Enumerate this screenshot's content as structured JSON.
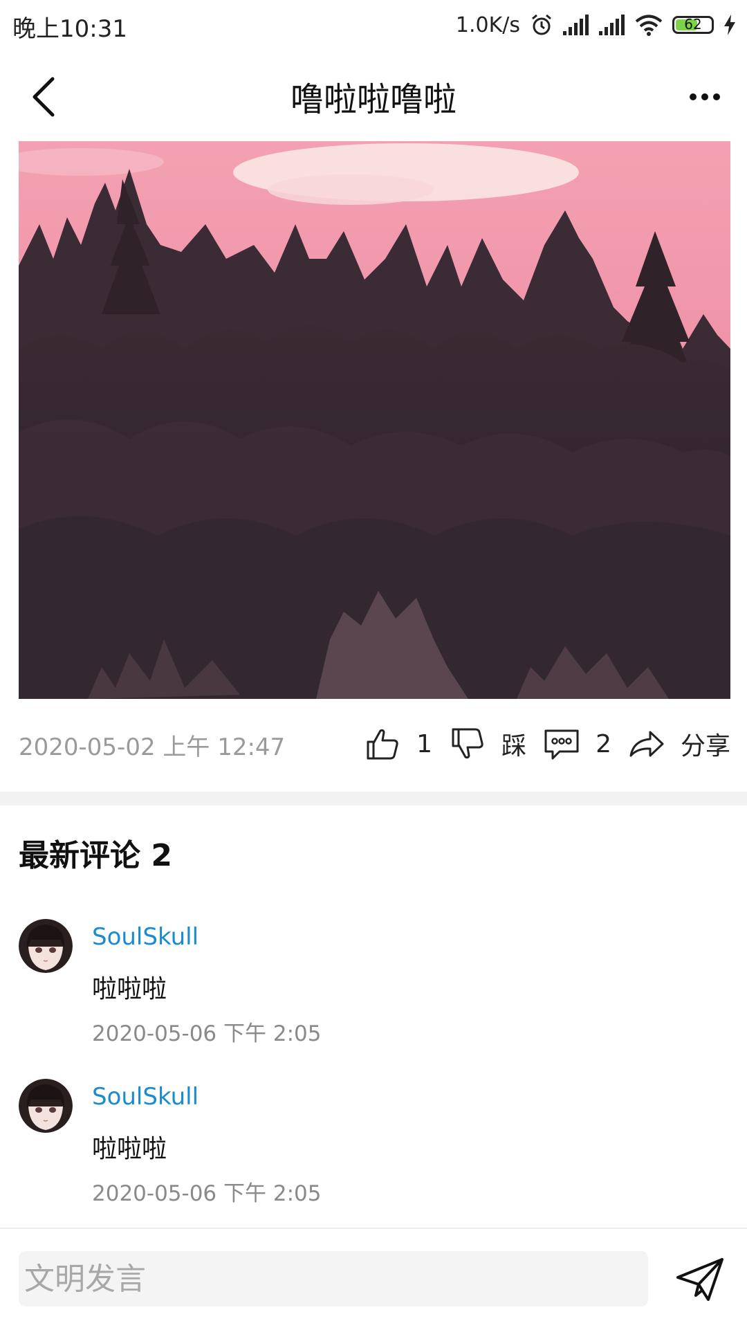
{
  "status_bar": {
    "time": "晚上10:31",
    "net_speed": "1.0K/s",
    "battery": "62",
    "battery_level": 0.62
  },
  "header": {
    "title": "噜啦啦噜啦",
    "icons": [
      "back-arrow-icon",
      "more-dots-icon"
    ]
  },
  "post": {
    "date": "2020-05-02 上午 12:47",
    "likes": "1",
    "dislike_label": "踩",
    "comments": "2",
    "share_label": "分享"
  },
  "comments_section": {
    "title": "最新评论 2",
    "items": [
      {
        "author": "SoulSkull",
        "text": "啦啦啦",
        "time": "2020-05-06 下午 2:05"
      },
      {
        "author": "SoulSkull",
        "text": "啦啦啦",
        "time": "2020-05-06 下午 2:05"
      }
    ]
  },
  "composer": {
    "placeholder": "文明发言"
  },
  "colors": {
    "author": "#1b8bd0",
    "battery": "#7bd348",
    "sky": "#f29aae"
  }
}
